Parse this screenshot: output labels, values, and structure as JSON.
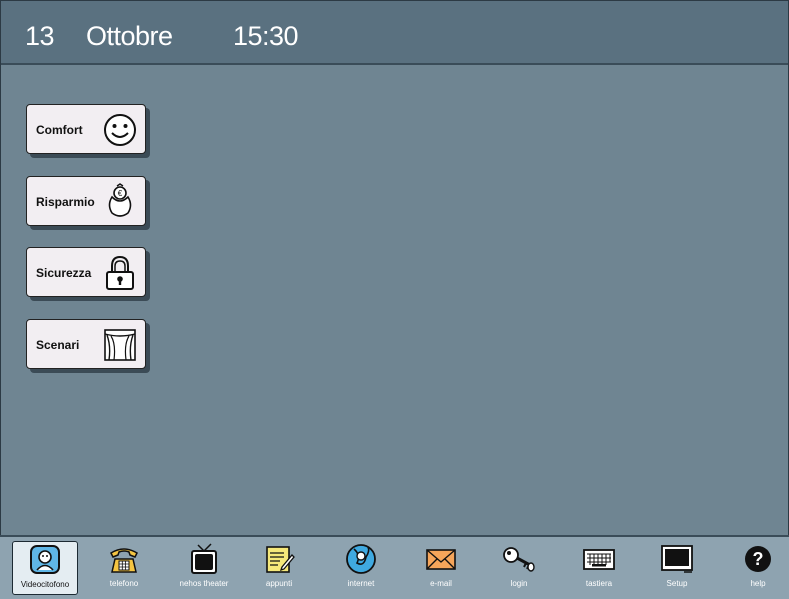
{
  "header": {
    "day": "13",
    "month": "Ottobre",
    "time": "15:30"
  },
  "menu": [
    {
      "label": "Comfort",
      "icon": "smiley-icon"
    },
    {
      "label": "Risparmio",
      "icon": "piggy-bank-icon"
    },
    {
      "label": "Sicurezza",
      "icon": "padlock-icon"
    },
    {
      "label": "Scenari",
      "icon": "theater-curtain-icon"
    }
  ],
  "taskbar": [
    {
      "label": "Videocitofono",
      "icon": "video-intercom-icon",
      "active": true
    },
    {
      "label": "telefono",
      "icon": "telephone-icon"
    },
    {
      "label": "nehos theater",
      "icon": "tv-icon"
    },
    {
      "label": "appunti",
      "icon": "notepad-icon"
    },
    {
      "label": "internet",
      "icon": "internet-icon"
    },
    {
      "label": "e-mail",
      "icon": "envelope-icon"
    },
    {
      "label": "login",
      "icon": "key-icon"
    },
    {
      "label": "tastiera",
      "icon": "keyboard-icon"
    },
    {
      "label": "Setup",
      "icon": "monitor-icon"
    },
    {
      "label": "help",
      "icon": "help-icon"
    }
  ],
  "colors": {
    "background": "#6f8592",
    "header": "#5a7180",
    "taskbar": "#8ea3b0",
    "button": "#f2eef2"
  }
}
